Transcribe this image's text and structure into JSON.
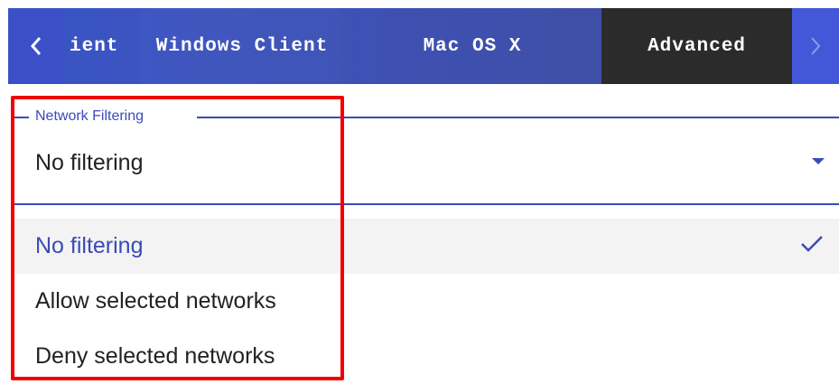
{
  "tabs": {
    "back_icon": "chevron-left-icon",
    "forward_icon": "chevron-right-icon",
    "items": [
      {
        "label": "ient",
        "active": false
      },
      {
        "label": "Windows Client",
        "active": false
      },
      {
        "label": "Mac OS X",
        "active": false
      },
      {
        "label": "Advanced",
        "active": true
      }
    ]
  },
  "network_filtering": {
    "label": "Network Filtering",
    "value": "No filtering",
    "options": [
      {
        "label": "No filtering",
        "selected": true
      },
      {
        "label": "Allow selected networks",
        "selected": false
      },
      {
        "label": "Deny selected networks",
        "selected": false
      }
    ]
  },
  "colors": {
    "accent": "#3a4bb8",
    "tab_bg": "#3f4fa7",
    "active_tab_bg": "#2b2b2b",
    "highlight": "#f20000"
  }
}
